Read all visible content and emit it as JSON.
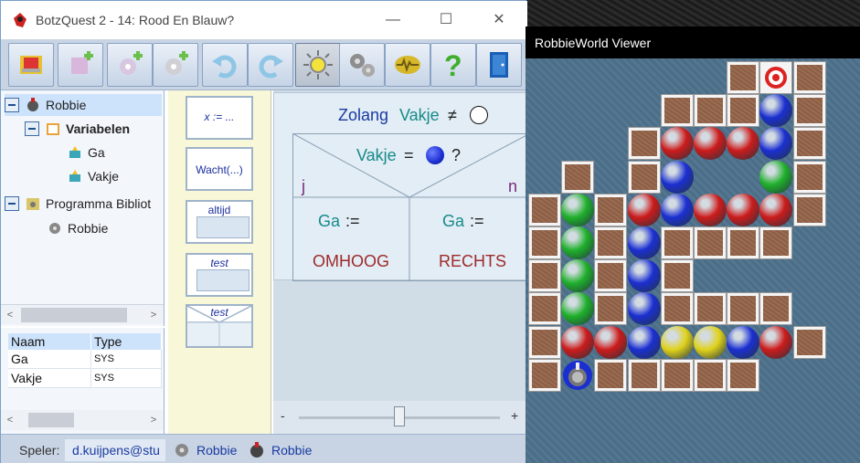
{
  "main_window": {
    "title": "BotzQuest 2 - 14: Rood En Blauw?",
    "minimize_glyph": "—",
    "maximize_glyph": "☐",
    "close_glyph": "✕"
  },
  "toolbar": {
    "buttons": [
      {
        "name": "eraser-tool-button",
        "icon": "eraser-icon"
      },
      {
        "name": "add-robot-button",
        "icon": "robot-add-icon"
      },
      {
        "name": "add-gear-button",
        "icon": "gear-add-icon"
      },
      {
        "name": "add-cog-button",
        "icon": "cog-add-icon"
      },
      {
        "name": "undo-button",
        "icon": "undo-icon"
      },
      {
        "name": "redo-button",
        "icon": "redo-icon"
      },
      {
        "name": "run-button",
        "icon": "sun-icon"
      },
      {
        "name": "settings-button",
        "icon": "gears-icon"
      },
      {
        "name": "debug-button",
        "icon": "badge-icon"
      },
      {
        "name": "help-button",
        "icon": "help-icon"
      },
      {
        "name": "exit-button",
        "icon": "door-icon"
      }
    ]
  },
  "tree": {
    "items": [
      {
        "label": "Robbie"
      },
      {
        "label": "Variabelen"
      },
      {
        "label": "Ga"
      },
      {
        "label": "Vakje"
      },
      {
        "label": "Programma Bibliot"
      },
      {
        "label": "Robbie"
      }
    ]
  },
  "var_table": {
    "headers": [
      "Naam",
      "Type"
    ],
    "rows": [
      {
        "name": "Ga",
        "type": "SYS"
      },
      {
        "name": "Vakje",
        "type": "SYS"
      }
    ]
  },
  "palette": {
    "assign": "x := ...",
    "wait": "Wacht(...)",
    "always": "altijd",
    "test1": "test",
    "test2": "test"
  },
  "structogram": {
    "while_kw": "Zolang",
    "while_var": "Vakje",
    "neq": "≠",
    "if_var": "Vakje",
    "eq": "=",
    "q": "?",
    "yes": "j",
    "no": "n",
    "left_var": "Ga",
    "right_var": "Ga",
    "assign": ":=",
    "left_value": "OMHOOG",
    "right_value": "RECHTS"
  },
  "zoom": {
    "minus": "-",
    "plus": "+",
    "level": 0.5
  },
  "status": {
    "player_label": "Speler:",
    "player_value": "d.kuijpens@stu",
    "item1": "Robbie",
    "item2": "Robbie"
  },
  "world": {
    "title": "RobbieWorld Viewer"
  },
  "colors": {
    "red_ball": "#cc1b1b",
    "blue_ball": "#1b2fd1",
    "green_ball": "#1fb02b",
    "yellow_ball": "#e0d21a"
  }
}
